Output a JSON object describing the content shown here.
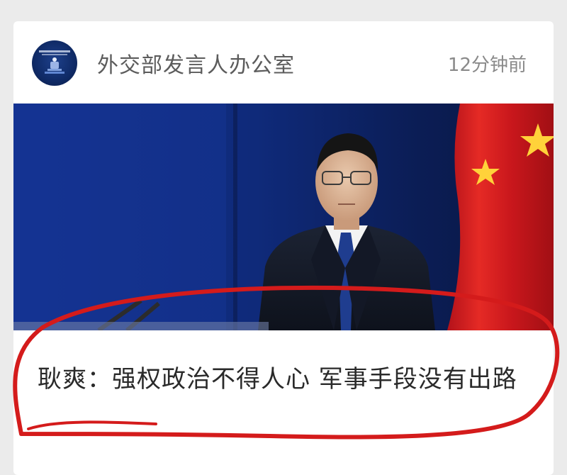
{
  "post": {
    "account_name": "外交部发言人办公室",
    "timestamp": "12分钟前",
    "avatar_icon": "ministry-emblem-icon",
    "thumbnail": "press-conference-photo",
    "headline": "耿爽：强权政治不得人心 军事手段没有出路"
  },
  "annotation": {
    "color": "#d41b1b",
    "description": "red-hand-drawn-circle"
  }
}
